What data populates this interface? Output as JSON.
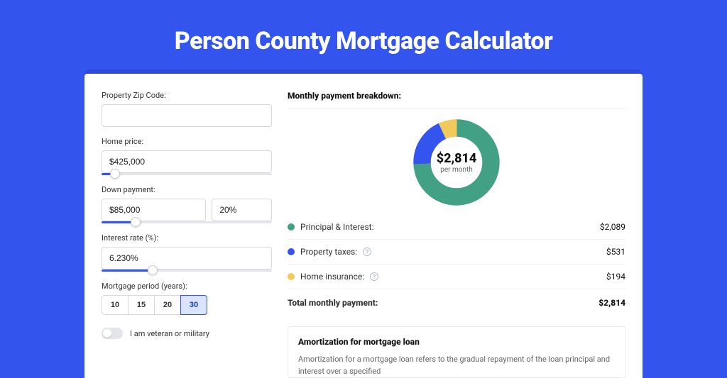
{
  "page": {
    "title": "Person County Mortgage Calculator"
  },
  "form": {
    "zip": {
      "label": "Property Zip Code:",
      "value": ""
    },
    "price": {
      "label": "Home price:",
      "value": "$425,000",
      "slider_pct": 8
    },
    "down": {
      "label": "Down payment:",
      "amount": "$85,000",
      "percent": "20%",
      "slider_pct": 20
    },
    "rate": {
      "label": "Interest rate (%):",
      "value": "6.230%",
      "slider_pct": 30
    },
    "period": {
      "label": "Mortgage period (years):",
      "options": [
        "10",
        "15",
        "20",
        "30"
      ],
      "selected": "30"
    },
    "veteran": {
      "label": "I am veteran or military",
      "checked": false
    }
  },
  "breakdown": {
    "title": "Monthly payment breakdown:",
    "amount": "$2,814",
    "sub": "per month",
    "items": [
      {
        "label": "Principal & Interest:",
        "value": "$2,089",
        "color": "#42a184",
        "info": false
      },
      {
        "label": "Property taxes:",
        "value": "$531",
        "color": "#3355ee",
        "info": true
      },
      {
        "label": "Home insurance:",
        "value": "$194",
        "color": "#f3c95c",
        "info": true
      }
    ],
    "total_label": "Total monthly payment:",
    "total_value": "$2,814"
  },
  "chart_data": {
    "type": "pie",
    "title": "Monthly payment breakdown",
    "series": [
      {
        "name": "Principal & Interest",
        "value": 2089,
        "color": "#42a184"
      },
      {
        "name": "Property taxes",
        "value": 531,
        "color": "#3355ee"
      },
      {
        "name": "Home insurance",
        "value": 194,
        "color": "#f3c95c"
      }
    ],
    "total": 2814
  },
  "amortization": {
    "title": "Amortization for mortgage loan",
    "text": "Amortization for a mortgage loan refers to the gradual repayment of the loan principal and interest over a specified"
  }
}
